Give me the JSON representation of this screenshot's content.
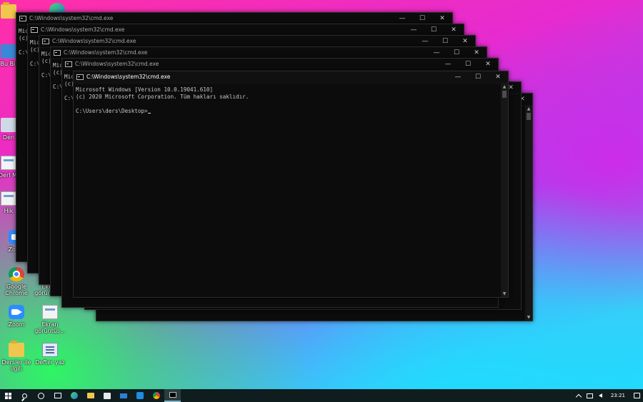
{
  "desktop_icons": [
    {
      "label": "Bu Bil",
      "icon": "computer-icon"
    },
    {
      "label": "Den",
      "icon": "generic-icon"
    },
    {
      "label": "Derl Mi",
      "icon": "document-icon"
    },
    {
      "label": "Hik",
      "icon": "document-icon"
    },
    {
      "label": "Zoom",
      "icon": "zoom-icon"
    },
    {
      "label": "Google Chrome",
      "icon": "chrome-icon"
    },
    {
      "label": "Ekran görüntüs...",
      "icon": "screenshot-icon"
    },
    {
      "label": "Zoom",
      "icon": "zoom-icon"
    },
    {
      "label": "Ekran görüntüs...",
      "icon": "screenshot-icon"
    },
    {
      "label": "Dersler ile ilgili",
      "icon": "folder-icon"
    },
    {
      "label": "Defter yaz",
      "icon": "notepad-icon"
    }
  ],
  "cmd": {
    "title": "C:\\Windows\\system32\\cmd.exe",
    "line1": "Microsoft Windows [Version 10.0.19041.610]",
    "line2": "(c) 2020 Microsoft Corporation. Tüm hakları saklıdır.",
    "prompt": "C:\\Users\\ders\\Desktop>",
    "bg_partial_1": "Mic",
    "bg_partial_2": "(c)",
    "bg_partial_3": "C:\\"
  },
  "controls": {
    "minimize": "—",
    "maximize": "☐",
    "close": "✕"
  },
  "taskbar": {
    "apps": [
      "start-icon",
      "search-icon",
      "cortana-icon",
      "task-view-icon",
      "edge-icon",
      "file-explorer-icon",
      "store-icon",
      "mail-icon",
      "zoom-icon",
      "chrome-icon",
      "cmd-icon"
    ],
    "clock": "23:21"
  }
}
